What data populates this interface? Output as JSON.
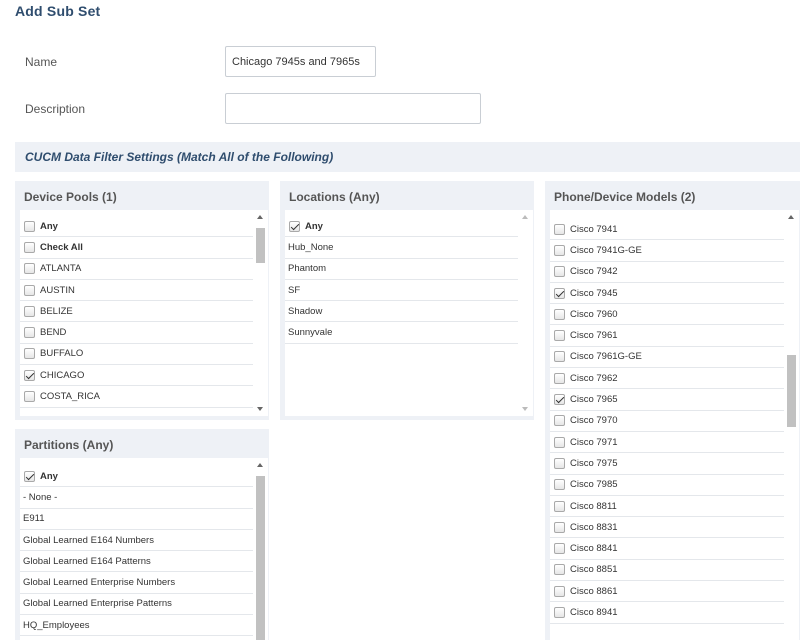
{
  "page": {
    "title": "Add Sub Set"
  },
  "form": {
    "name_label": "Name",
    "name_value": "Chicago 7945s and 7965s",
    "description_label": "Description",
    "description_value": ""
  },
  "filter_section": {
    "title": "CUCM Data Filter Settings (Match All of the Following)"
  },
  "device_pools": {
    "title": "Device Pools (1)",
    "items": [
      {
        "label": "Any",
        "checked": false,
        "bold": true
      },
      {
        "label": "Check All",
        "checked": false,
        "bold": true
      },
      {
        "label": "ATLANTA",
        "checked": false
      },
      {
        "label": "AUSTIN",
        "checked": false
      },
      {
        "label": "BELIZE",
        "checked": false
      },
      {
        "label": "BEND",
        "checked": false
      },
      {
        "label": "BUFFALO",
        "checked": false
      },
      {
        "label": "CHICAGO",
        "checked": true
      },
      {
        "label": "COSTA_RICA",
        "checked": false
      }
    ]
  },
  "locations": {
    "title": "Locations (Any)",
    "items": [
      {
        "label": "Any",
        "checked": true,
        "bold": true
      },
      {
        "label": "Hub_None"
      },
      {
        "label": "Phantom"
      },
      {
        "label": "SF"
      },
      {
        "label": "Shadow"
      },
      {
        "label": "Sunnyvale"
      }
    ]
  },
  "phone_models": {
    "title": "Phone/Device Models (2)",
    "items": [
      {
        "label": "Cisco 7941",
        "checked": false
      },
      {
        "label": "Cisco 7941G-GE",
        "checked": false
      },
      {
        "label": "Cisco 7942",
        "checked": false
      },
      {
        "label": "Cisco 7945",
        "checked": true
      },
      {
        "label": "Cisco 7960",
        "checked": false
      },
      {
        "label": "Cisco 7961",
        "checked": false
      },
      {
        "label": "Cisco 7961G-GE",
        "checked": false
      },
      {
        "label": "Cisco 7962",
        "checked": false
      },
      {
        "label": "Cisco 7965",
        "checked": true
      },
      {
        "label": "Cisco 7970",
        "checked": false
      },
      {
        "label": "Cisco 7971",
        "checked": false
      },
      {
        "label": "Cisco 7975",
        "checked": false
      },
      {
        "label": "Cisco 7985",
        "checked": false
      },
      {
        "label": "Cisco 8811",
        "checked": false
      },
      {
        "label": "Cisco 8831",
        "checked": false
      },
      {
        "label": "Cisco 8841",
        "checked": false
      },
      {
        "label": "Cisco 8851",
        "checked": false
      },
      {
        "label": "Cisco 8861",
        "checked": false
      },
      {
        "label": "Cisco 8941",
        "checked": false
      }
    ]
  },
  "partitions": {
    "title": "Partitions (Any)",
    "items": [
      {
        "label": "Any",
        "checked": true,
        "bold": true
      },
      {
        "label": "- None -"
      },
      {
        "label": "E911"
      },
      {
        "label": "Global Learned E164 Numbers"
      },
      {
        "label": "Global Learned E164 Patterns"
      },
      {
        "label": "Global Learned Enterprise Numbers"
      },
      {
        "label": "Global Learned Enterprise Patterns"
      },
      {
        "label": "HQ_Employees"
      }
    ]
  }
}
